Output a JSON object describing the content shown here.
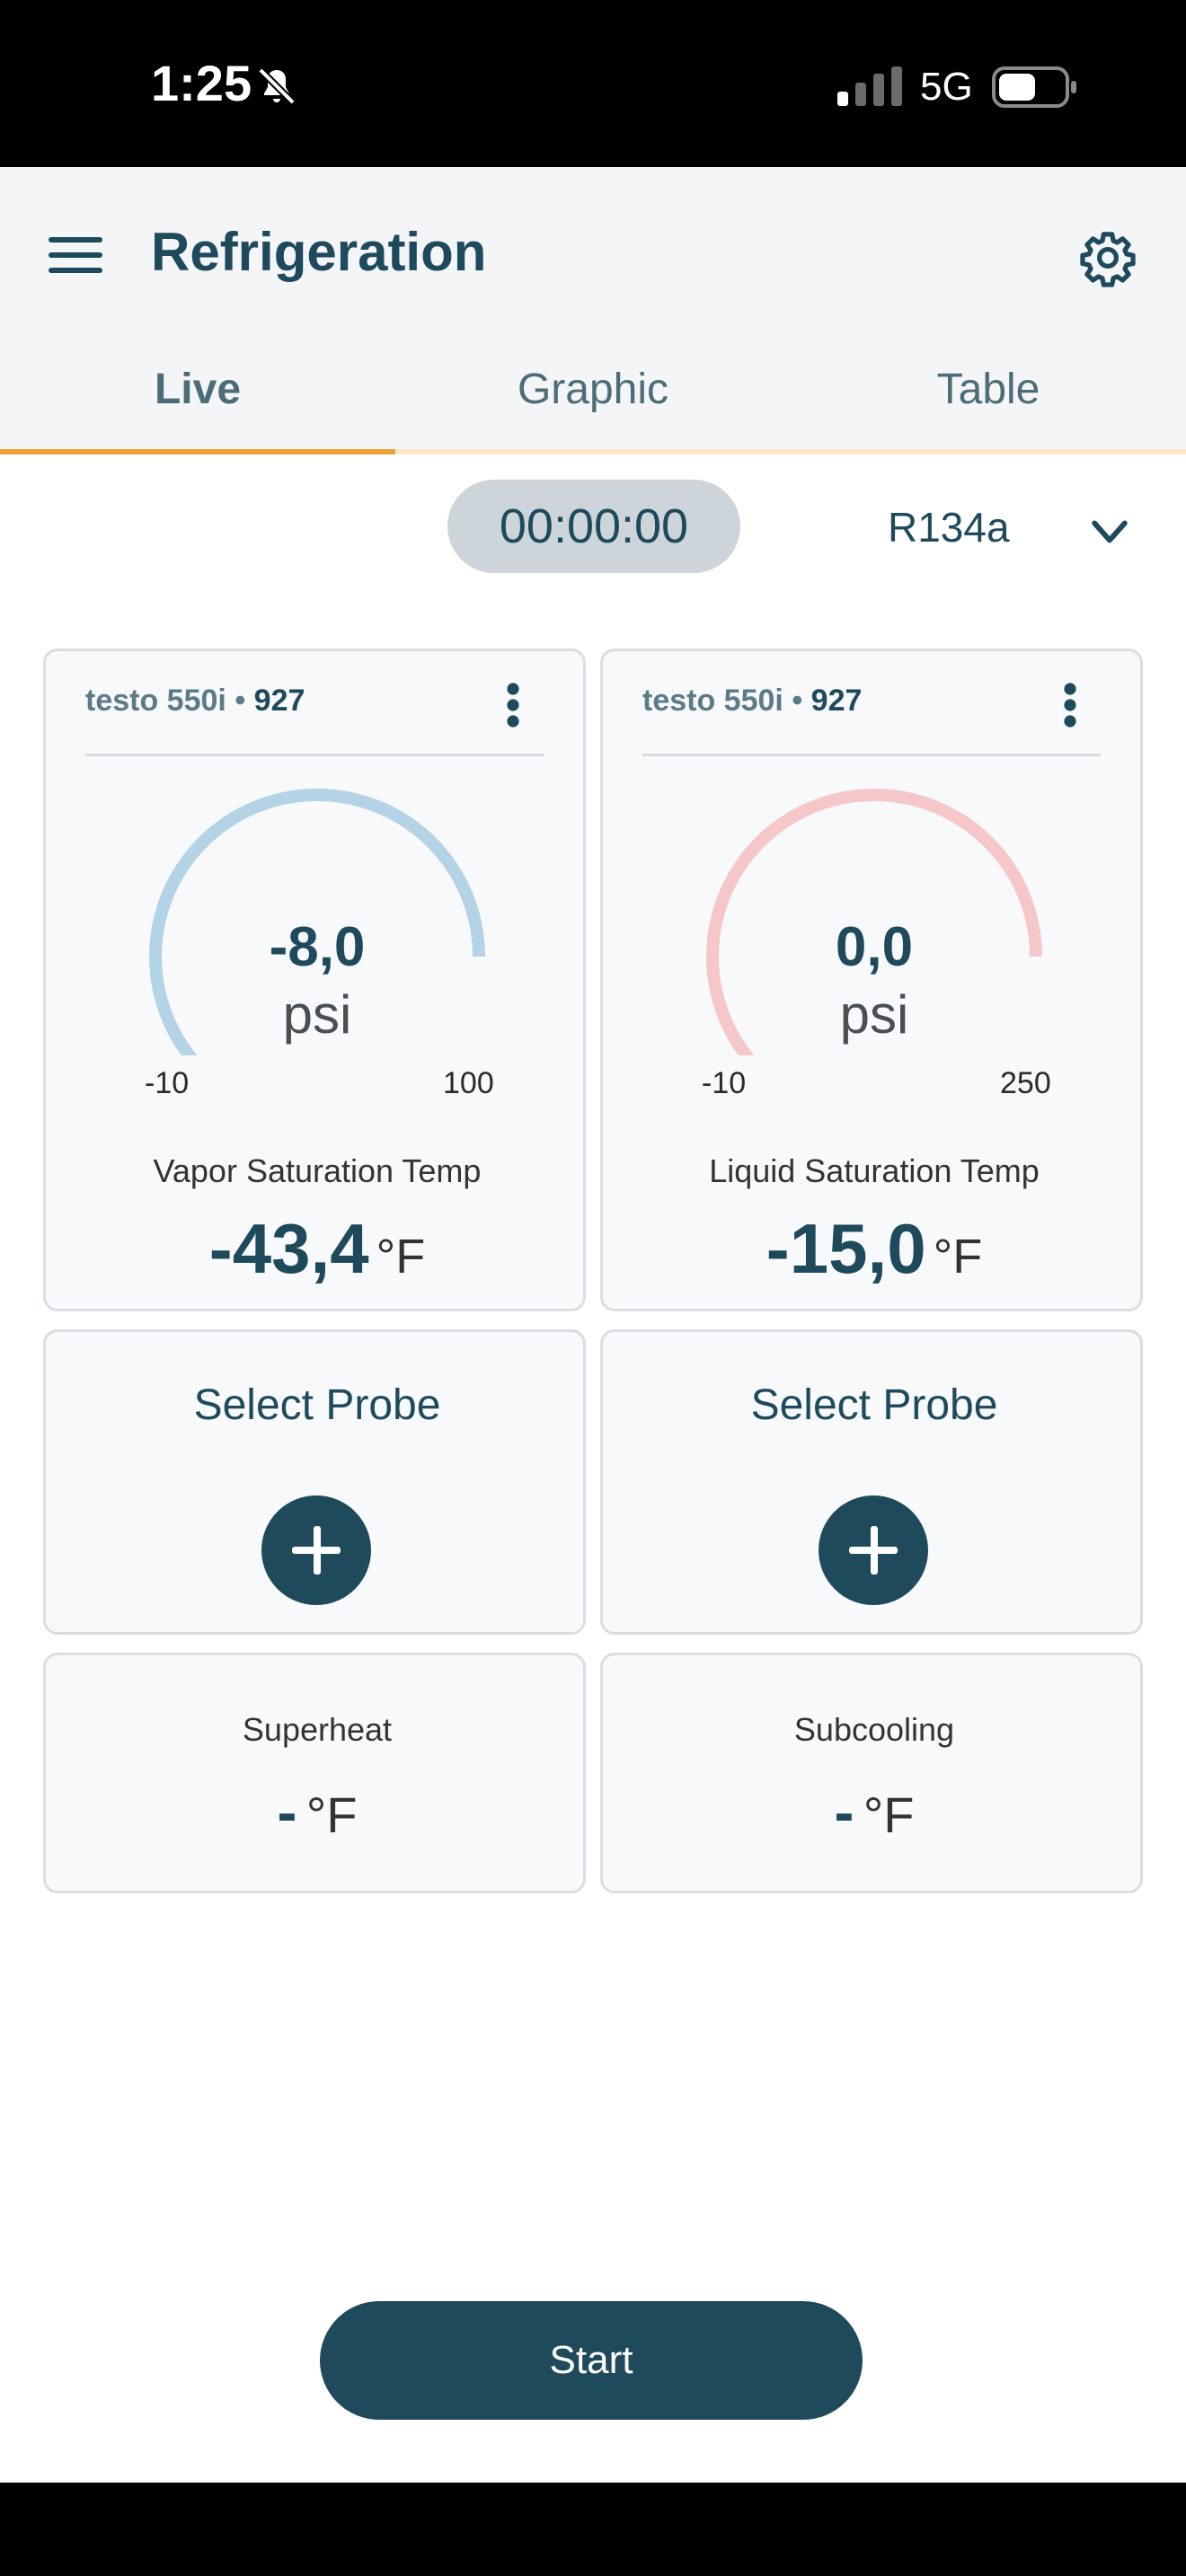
{
  "status_bar": {
    "time": "1:25",
    "network": "5G",
    "icons": [
      "bell-slash-icon",
      "signal-icon",
      "battery-icon"
    ]
  },
  "header": {
    "title": "Refrigeration",
    "icons": [
      "menu-icon",
      "gear-icon"
    ]
  },
  "tabs": [
    {
      "label": "Live",
      "active": true
    },
    {
      "label": "Graphic",
      "active": false
    },
    {
      "label": "Table",
      "active": false
    }
  ],
  "toolbar": {
    "timer": "00:00:00",
    "refrigerant": "R134a"
  },
  "gauges": [
    {
      "device": "testo 550i",
      "separator": "•",
      "serial": "927",
      "value": "-8,0",
      "unit": "psi",
      "min": "-10",
      "max": "100",
      "fill_fraction": 0.018,
      "track_color": "#b5d3e6",
      "fill_color": "#1a6da8",
      "sat_label": "Vapor Saturation Temp",
      "sat_value": "-43,4",
      "sat_unit": "°F"
    },
    {
      "device": "testo 550i",
      "separator": "•",
      "serial": "927",
      "value": "0,0",
      "unit": "psi",
      "min": "-10",
      "max": "250",
      "fill_fraction": 0.0,
      "track_color": "#f6c7c9",
      "fill_color": "#e0353d",
      "sat_label": "Liquid Saturation Temp",
      "sat_value": "-15,0",
      "sat_unit": "°F"
    }
  ],
  "probes": [
    {
      "label": "Select Probe"
    },
    {
      "label": "Select Probe"
    }
  ],
  "calculated": [
    {
      "label": "Superheat",
      "value": "-",
      "unit": "°F"
    },
    {
      "label": "Subcooling",
      "value": "-",
      "unit": "°F"
    }
  ],
  "start_label": "Start",
  "colors": {
    "primary": "#1e4a5c",
    "tab_accent": "#eea437"
  }
}
